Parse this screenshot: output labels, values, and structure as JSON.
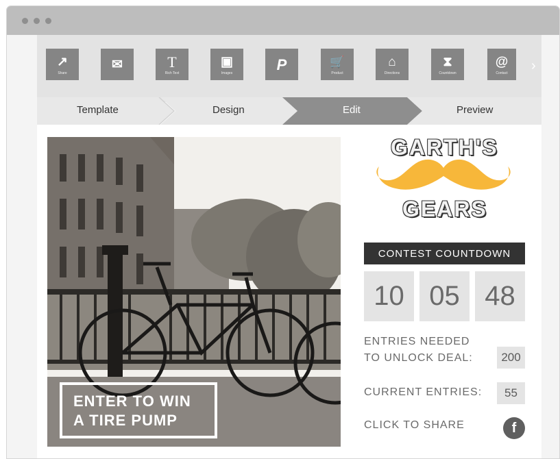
{
  "toolbar": {
    "tools": [
      {
        "icon": "share-icon",
        "glyph": "↗",
        "label": "Share"
      },
      {
        "icon": "mail-icon",
        "glyph": "✉",
        "label": ""
      },
      {
        "icon": "rich-text-icon",
        "glyph": "T",
        "label": "Rich Text"
      },
      {
        "icon": "images-icon",
        "glyph": "▣",
        "label": "Images"
      },
      {
        "icon": "paypal-icon",
        "glyph": "P",
        "label": ""
      },
      {
        "icon": "product-cart-icon",
        "glyph": "🛒",
        "label": "Product"
      },
      {
        "icon": "directions-icon",
        "glyph": "⌂",
        "label": "Directions"
      },
      {
        "icon": "countdown-hourglass-icon",
        "glyph": "⧗",
        "label": "Countdown"
      },
      {
        "icon": "contact-icon",
        "glyph": "@",
        "label": "Contact"
      }
    ],
    "next_icon": "chevron-right-icon",
    "next_glyph": "›"
  },
  "steps": {
    "items": [
      "Template",
      "Design",
      "Edit",
      "Preview"
    ],
    "active_index": 2,
    "colors": {
      "inactive": "#e8e8e8",
      "active": "#8e8e8e"
    }
  },
  "promo": {
    "line1": "ENTER TO WIN",
    "line2": "A TIRE PUMP"
  },
  "brand": {
    "line1": "GARTH'S",
    "line2": "GEARS",
    "mustache_color": "#f7b73a"
  },
  "contest": {
    "title": "CONTEST COUNTDOWN",
    "countdown": [
      "10",
      "05",
      "48"
    ],
    "entries_needed_line1": "ENTRIES NEEDED",
    "entries_needed_line2": "TO UNLOCK DEAL:",
    "entries_needed_value": "200",
    "current_entries_label": "CURRENT ENTRIES:",
    "current_entries_value": "55",
    "share_label": "CLICK TO SHARE",
    "share_icon": "facebook-icon",
    "share_glyph": "f"
  }
}
